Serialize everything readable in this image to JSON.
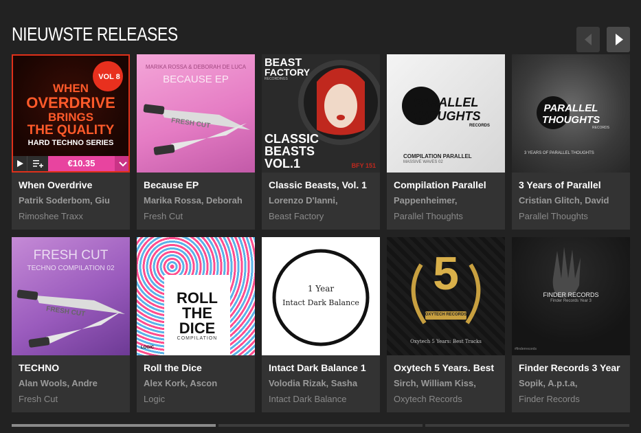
{
  "section": {
    "title": "NIEUWSTE RELEASES"
  },
  "releases": [
    {
      "title": "When Overdrive",
      "artist": "Patrik Soderbom, Giu",
      "label": "Rimoshee Traxx",
      "art": {
        "lines": [
          "WHEN",
          "OVERDRIVE",
          "BRINGS",
          "THE QUALITY",
          "HARD TECHNO SERIES"
        ],
        "badge": "VOL 8"
      },
      "price": "€10.35"
    },
    {
      "title": "Because EP",
      "artist": "Marika Rossa, Deborah",
      "label": "Fresh Cut",
      "art": {
        "lines": [
          "MARIKA ROSSA & DEBORAH DE LUCA",
          "BECAUSE EP",
          "FRESH CUT"
        ]
      }
    },
    {
      "title": "Classic Beasts, Vol. 1",
      "artist": "Lorenzo D'Ianni,",
      "label": "Beast Factory",
      "art": {
        "lines": [
          "BEAST",
          "FACTORY",
          "RECORDINGS",
          "CLASSIC",
          "BEASTS",
          "VOL.1",
          "BFY 151"
        ]
      }
    },
    {
      "title": "Compilation Parallel",
      "artist": "Pappenheimer,",
      "label": "Parallel Thoughts",
      "art": {
        "lines": [
          "PARALLEL",
          "THOUGHTS",
          "RECORDS",
          "COMPILATION PARALLEL",
          "MASSIVE WAVES 02"
        ]
      }
    },
    {
      "title": "3 Years of Parallel",
      "artist": "Cristian Glitch, David",
      "label": "Parallel Thoughts",
      "art": {
        "lines": [
          "PARALLEL",
          "THOUGHTS",
          "RECORDS",
          "3 YEARS OF PARALLEL THOUGHTS"
        ]
      }
    },
    {
      "title": "TECHNO",
      "artist": "Alan Wools, Andre",
      "label": "Fresh Cut",
      "art": {
        "lines": [
          "FRESH CUT",
          "TECHNO COMPILATION 02",
          "FRESH CUT"
        ]
      }
    },
    {
      "title": "Roll the Dice",
      "artist": "Alex Kork, Ascon",
      "label": "Logic",
      "art": {
        "lines": [
          "ROLL",
          "THE",
          "DICE",
          "COMPILATION",
          "LOGIC"
        ]
      }
    },
    {
      "title": "Intact Dark Balance 1",
      "artist": "Volodia Rizak, Sasha",
      "label": "Intact Dark Balance",
      "art": {
        "lines": [
          "1 Year",
          "Intact Dark Balance"
        ]
      }
    },
    {
      "title": "Oxytech 5 Years. Best",
      "artist": "Sirch, William Kiss,",
      "label": "Oxytech Records",
      "art": {
        "lines": [
          "5",
          "OXYTECH RECORDS",
          "Oxytech 5 Years: Best Tracks"
        ]
      }
    },
    {
      "title": "Finder Records 3 Year",
      "artist": "Sopik, A.p.t.a,",
      "label": "Finder Records",
      "art": {
        "lines": [
          "FINDER RECORDS",
          "Finder Records Year 3",
          "#finderrecords"
        ]
      }
    }
  ],
  "colors": {
    "accent": "#e8449f",
    "background": "#222222",
    "card": "#333333"
  },
  "icons": {
    "prev": "chevron-left-icon",
    "next": "chevron-right-icon",
    "play": "play-icon",
    "queue": "add-to-queue-icon",
    "more": "chevron-down-icon"
  }
}
